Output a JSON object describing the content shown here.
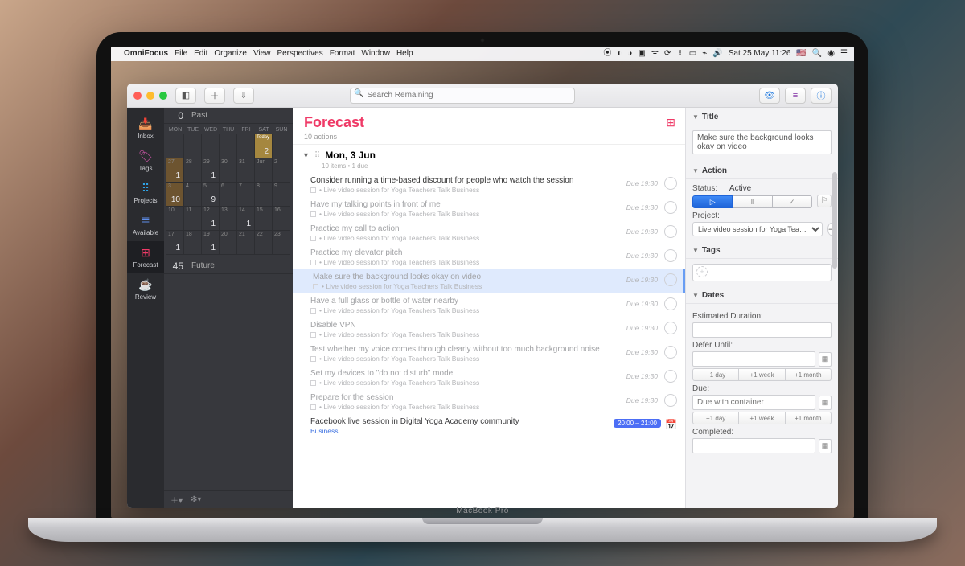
{
  "menubar": {
    "app": "OmniFocus",
    "items": [
      "File",
      "Edit",
      "Organize",
      "View",
      "Perspectives",
      "Format",
      "Window",
      "Help"
    ],
    "clock": "Sat 25 May  11:26"
  },
  "toolbar": {
    "search_placeholder": "Search Remaining"
  },
  "sidebar": {
    "items": [
      {
        "label": "Inbox",
        "icon": "📥"
      },
      {
        "label": "Tags",
        "icon": "🏷"
      },
      {
        "label": "Projects",
        "icon": "⠿"
      },
      {
        "label": "Available",
        "icon": "≣"
      },
      {
        "label": "Forecast",
        "icon": "⊞"
      },
      {
        "label": "Review",
        "icon": "☕"
      }
    ]
  },
  "cal": {
    "past": {
      "count": "0",
      "label": "Past"
    },
    "future": {
      "count": "45",
      "label": "Future"
    },
    "dow": [
      "MON",
      "TUE",
      "WED",
      "THU",
      "FRI",
      "SAT",
      "SUN"
    ],
    "weeks": [
      [
        {
          "d": ""
        },
        {
          "d": ""
        },
        {
          "d": ""
        },
        {
          "d": ""
        },
        {
          "d": ""
        },
        {
          "d": "Today",
          "n": "2"
        },
        {
          "d": ""
        }
      ],
      [
        {
          "d": "27",
          "n": "1"
        },
        {
          "d": "28"
        },
        {
          "d": "29",
          "n": "1"
        },
        {
          "d": "30"
        },
        {
          "d": "31"
        },
        {
          "d": "Jun"
        },
        {
          "d": "2"
        }
      ],
      [
        {
          "d": "3",
          "n": "10"
        },
        {
          "d": "4"
        },
        {
          "d": "5",
          "n": "9"
        },
        {
          "d": "6"
        },
        {
          "d": "7"
        },
        {
          "d": "8"
        },
        {
          "d": "9"
        }
      ],
      [
        {
          "d": "10"
        },
        {
          "d": "11"
        },
        {
          "d": "12",
          "n": "1"
        },
        {
          "d": "13"
        },
        {
          "d": "14",
          "n": "1"
        },
        {
          "d": "15"
        },
        {
          "d": "16"
        }
      ],
      [
        {
          "d": "17",
          "n": "1"
        },
        {
          "d": "18"
        },
        {
          "d": "19",
          "n": "1"
        },
        {
          "d": "20"
        },
        {
          "d": "21"
        },
        {
          "d": "22"
        },
        {
          "d": "23"
        }
      ]
    ]
  },
  "main": {
    "title": "Forecast",
    "subtitle": "10 actions",
    "section": {
      "title": "Mon, 3 Jun",
      "sub": "10 items • 1 due"
    },
    "project_line": "• Live video session for Yoga Teachers Talk Business",
    "due": "Due 19:30",
    "tasks": [
      {
        "t": "Consider running a time-based discount for people who watch the session",
        "bold": true
      },
      {
        "t": "Have my talking points in front of me"
      },
      {
        "t": "Practice my call to action"
      },
      {
        "t": "Practice my elevator pitch"
      },
      {
        "t": "Make sure the background looks okay on video",
        "sel": true
      },
      {
        "t": "Have a full glass or bottle of water nearby"
      },
      {
        "t": "Disable VPN"
      },
      {
        "t": "Test whether my voice comes through clearly without too much background noise"
      },
      {
        "t": "Set my devices to \"do not disturb\" mode"
      },
      {
        "t": "Prepare for the session"
      }
    ],
    "event": {
      "t": "Facebook live session in Digital Yoga Academy community",
      "cat": "Business",
      "time": "20:00 – 21:00"
    }
  },
  "insp": {
    "title_label": "Title",
    "title_text": "Make sure the background looks okay on video",
    "action_label": "Action",
    "status_label": "Status:",
    "status_value": "Active",
    "project_label": "Project:",
    "project_value": "Live video session for Yoga Tea…",
    "tags_label": "Tags",
    "dates_label": "Dates",
    "est_label": "Estimated Duration:",
    "defer_label": "Defer Until:",
    "due_label": "Due:",
    "due_placeholder": "Due with container",
    "completed_label": "Completed:",
    "quick": [
      "+1 day",
      "+1 week",
      "+1 month"
    ]
  },
  "mbp": "MacBook Pro"
}
